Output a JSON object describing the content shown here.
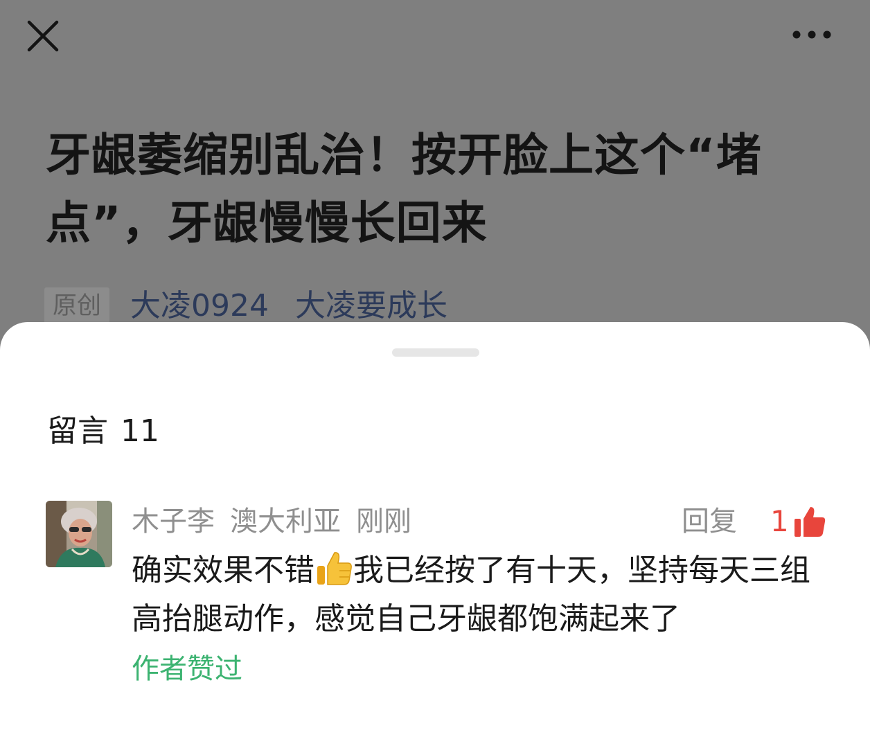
{
  "header": {
    "close_icon": "close-icon",
    "more_icon": "more-icon"
  },
  "article": {
    "title": "牙龈萎缩别乱治！按开脸上这个“堵点”，牙龈慢慢长回来",
    "original_tag": "原创",
    "author": "大凌0924",
    "account": "大凌要成长"
  },
  "comments_panel": {
    "title": "留言",
    "count": "11",
    "comments": [
      {
        "name": "木子李",
        "location": "澳大利亚",
        "time": "刚刚",
        "reply_label": "回复",
        "like_count": "1",
        "text_before_emoji": "确实效果不错",
        "emoji": "thumbs-up-emoji",
        "text_after_emoji": "我已经按了有十天，坚持每天三组高抬腿动作，感觉自己牙龈都饱满起来了",
        "author_liked_label": "作者赞过"
      }
    ]
  },
  "colors": {
    "overlay": "#7f7f7f",
    "like": "#e8453c",
    "author_liked": "#3cb371",
    "muted_text": "#8f8f8f",
    "link": "#2c3a5a"
  }
}
